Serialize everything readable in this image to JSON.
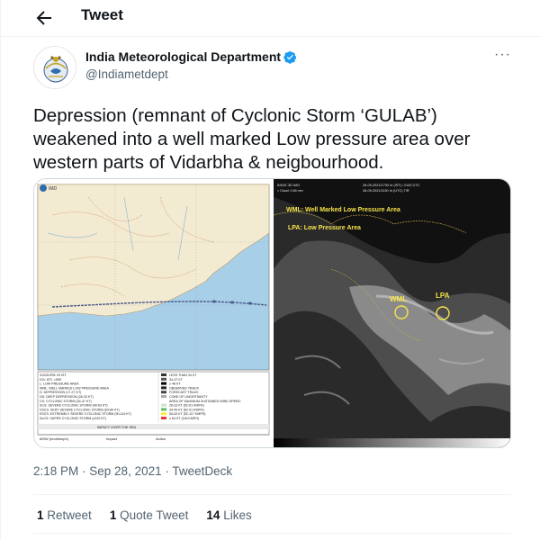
{
  "header": {
    "title": "Tweet"
  },
  "author": {
    "name": "India Meteorological Department",
    "handle": "@Indiametdept"
  },
  "tweet": {
    "text": "Depression (remnant of Cyclonic Storm ‘GULAB’) weakened into a well marked Low pressure area over western parts of Vidarbha & neigbourhood."
  },
  "media": {
    "left_panel": {
      "logo_text": "IMD",
      "legend_lines": [
        "31/03/1PM: IN IST",
        "D3= 6TC =D9E",
        "L: LOW PRESSURE AREA",
        "WML: WELL MARKED LOW PRESSURE AREA",
        "D: DEPRESSION (17-27 KT)",
        "DD: DEEP DEPRESSION (28-33 KT)",
        "CS: CYCLONIC STORM (34-47 KT)",
        "SCS: SEVERE CYCLONIC STORM (48-63 KT)",
        "VSCS: VERY SEVERE CYCLONIC STORM (64-89 KT)",
        "ESCS: EXTREMELY SEVERE CYCLONIC STORM (90-119 KT)",
        "SuCS: SUPER CYCLONIC STORM (≥120 KT)"
      ],
      "key_lines": [
        "LESS THAN 34 KT",
        "34-47 KT",
        "≥ 48 KT",
        "OBSERVED TRACK",
        "FORECAST TRACK",
        "CONE OF UNCERTAINTY",
        "AREA OF MAXIMUM SUSTAINED WIND SPEED:",
        "28-33 KT (52-61 KMPH)",
        "34-49 KT (62-91 KMPH)",
        "50-63 KT (92-117 KMPH)",
        "≥ 64 KT (118 KMPH)"
      ],
      "footer_label": "IMPACT OVER THE SEA",
      "table_headers": [
        "MSW (knot/kmph)",
        "Impact",
        "Action"
      ]
    },
    "right_panel": {
      "top_left": "INSAT-3D IMG",
      "top_left_2": "> Cloud: 0-65 mm",
      "top_center": "28-09-2021/1700 hr (IST) / 2100 UTC",
      "top_center_2": "28-09-2021/1130 hr (UTC) TIR",
      "label_wml": "WML: Well Marked Low Pressure Area",
      "label_lpa": "LPA: Low Pressure Area",
      "marker_wml": "WML",
      "marker_lpa": "LPA"
    }
  },
  "meta": {
    "time": "2:18 PM",
    "date": "Sep 28, 2021",
    "source": "TweetDeck",
    "separator": " · "
  },
  "stats": {
    "retweets_count": "1",
    "retweets_label": "Retweet",
    "quotes_count": "1",
    "quotes_label": "Quote Tweet",
    "likes_count": "14",
    "likes_label": "Likes"
  },
  "colors": {
    "accent": "#1d9bf0",
    "muted": "#536471",
    "text": "#0f1419",
    "sea": "#a8cfe8",
    "land": "#f3ead2",
    "track": "#4a5a8a"
  }
}
